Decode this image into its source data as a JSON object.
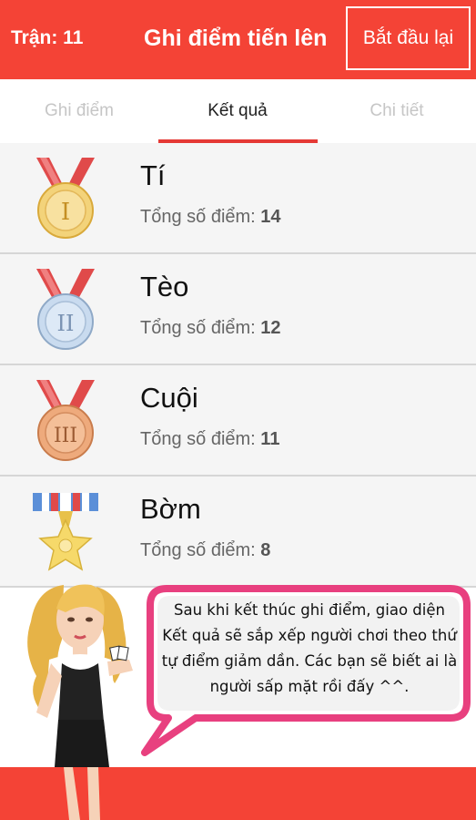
{
  "header": {
    "round_label": "Trận: 11",
    "title": "Ghi điểm tiến lên",
    "restart_label": "Bắt đầu lại"
  },
  "tabs": [
    {
      "label": "Ghi điểm",
      "active": false
    },
    {
      "label": "Kết quả",
      "active": true
    },
    {
      "label": "Chi tiết",
      "active": false
    }
  ],
  "results": [
    {
      "name": "Tí",
      "score_label": "Tổng số điểm: ",
      "score": "14",
      "medal": "gold-medal-icon",
      "medal_numeral": "I"
    },
    {
      "name": "Tèo",
      "score_label": "Tổng số điểm: ",
      "score": "12",
      "medal": "silver-medal-icon",
      "medal_numeral": "II"
    },
    {
      "name": "Cuội",
      "score_label": "Tổng số điểm: ",
      "score": "11",
      "medal": "bronze-medal-icon",
      "medal_numeral": "III"
    },
    {
      "name": "Bờm",
      "score_label": "Tổng số điểm: ",
      "score": "8",
      "medal": "star-medal-icon"
    }
  ],
  "tip": {
    "text": "Sau khi kết thúc ghi điểm, giao diện Kết quả sẽ sắp xếp người chơi theo thứ tự điểm giảm dần. Các bạn sẽ biết ai là người sấp mặt rồi đấy ^^."
  },
  "colors": {
    "accent": "#f44336",
    "tab_underline": "#e53935",
    "bubble_border": "#e8407f"
  }
}
